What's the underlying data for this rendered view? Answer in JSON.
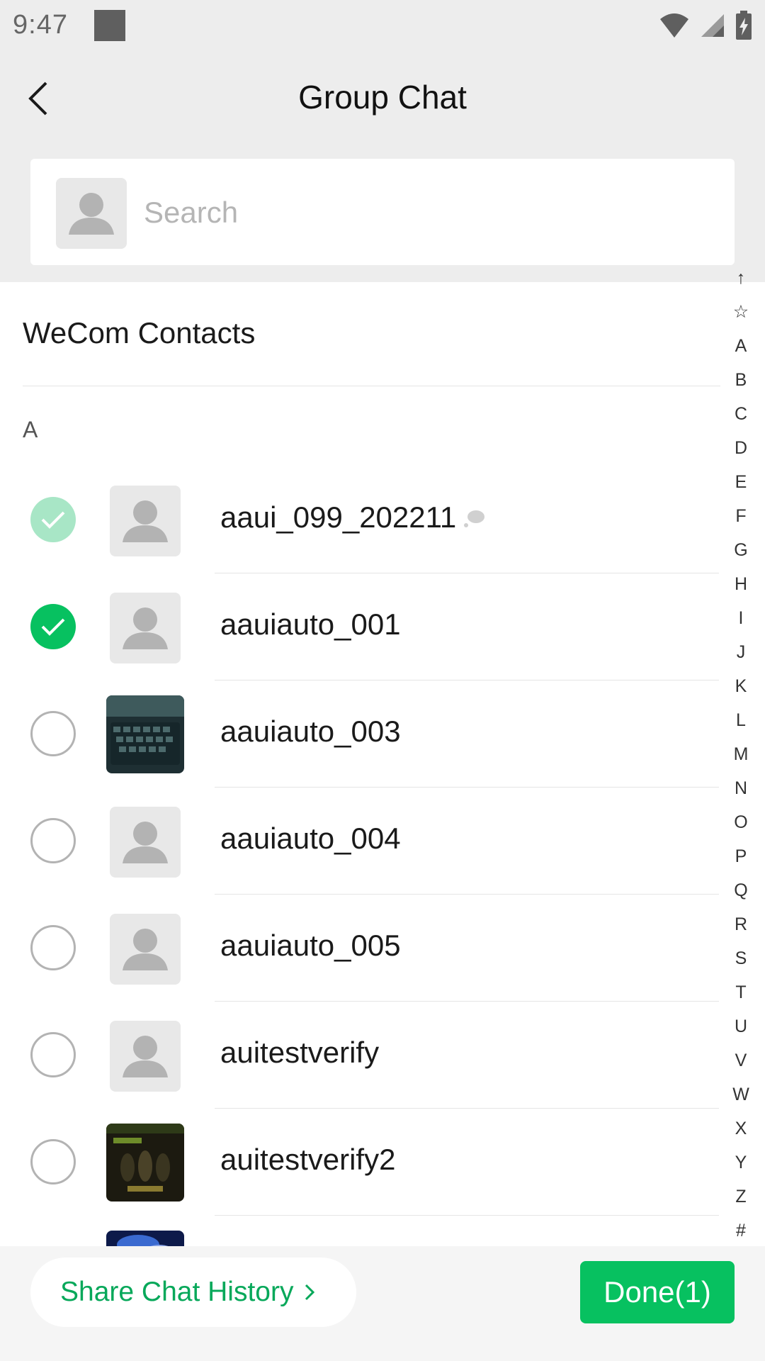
{
  "status_bar": {
    "time": "9:47"
  },
  "header": {
    "title": "Group Chat"
  },
  "search": {
    "placeholder": "Search"
  },
  "section": {
    "title": "WeCom Contacts",
    "letter": "A"
  },
  "contacts": [
    {
      "name": "aaui_099_202211",
      "state": "disabled-checked",
      "avatar": "default-avatar-icon"
    },
    {
      "name": "aauiauto_001",
      "state": "checked",
      "avatar": "default-avatar-icon"
    },
    {
      "name": "aauiauto_003",
      "state": "unchecked",
      "avatar": "keyboard-photo"
    },
    {
      "name": "aauiauto_004",
      "state": "unchecked",
      "avatar": "default-avatar-icon"
    },
    {
      "name": "aauiauto_005",
      "state": "unchecked",
      "avatar": "default-avatar-icon"
    },
    {
      "name": "auitestverify",
      "state": "unchecked",
      "avatar": "default-avatar-icon"
    },
    {
      "name": "auitestverify2",
      "state": "unchecked",
      "avatar": "poster-photo"
    },
    {
      "name": "",
      "state": "unchecked",
      "avatar": "blue-photo"
    }
  ],
  "alpha_index": [
    "↑",
    "☆",
    "A",
    "B",
    "C",
    "D",
    "E",
    "F",
    "G",
    "H",
    "I",
    "J",
    "K",
    "L",
    "M",
    "N",
    "O",
    "P",
    "Q",
    "R",
    "S",
    "T",
    "U",
    "V",
    "W",
    "X",
    "Y",
    "Z",
    "#"
  ],
  "bottom": {
    "share_label": "Share Chat History",
    "done_label": "Done(1)"
  },
  "colors": {
    "accent": "#07c160",
    "accent_disabled": "#a8e6c6",
    "background": "#ededed"
  }
}
